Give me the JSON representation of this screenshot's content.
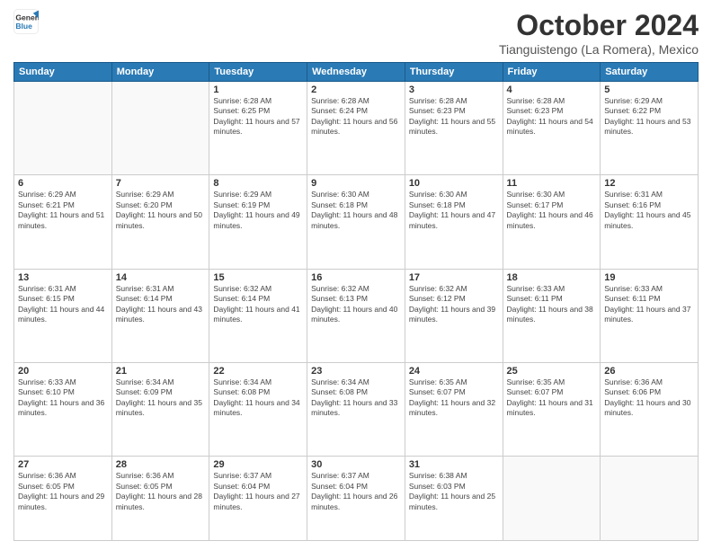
{
  "logo": {
    "line1": "General",
    "line2": "Blue"
  },
  "header": {
    "month": "October 2024",
    "location": "Tianguistengo (La Romera), Mexico"
  },
  "days_of_week": [
    "Sunday",
    "Monday",
    "Tuesday",
    "Wednesday",
    "Thursday",
    "Friday",
    "Saturday"
  ],
  "weeks": [
    [
      {
        "day": "",
        "empty": true
      },
      {
        "day": "",
        "empty": true
      },
      {
        "day": "1",
        "sunrise": "6:28 AM",
        "sunset": "6:25 PM",
        "daylight": "11 hours and 57 minutes."
      },
      {
        "day": "2",
        "sunrise": "6:28 AM",
        "sunset": "6:24 PM",
        "daylight": "11 hours and 56 minutes."
      },
      {
        "day": "3",
        "sunrise": "6:28 AM",
        "sunset": "6:23 PM",
        "daylight": "11 hours and 55 minutes."
      },
      {
        "day": "4",
        "sunrise": "6:28 AM",
        "sunset": "6:23 PM",
        "daylight": "11 hours and 54 minutes."
      },
      {
        "day": "5",
        "sunrise": "6:29 AM",
        "sunset": "6:22 PM",
        "daylight": "11 hours and 53 minutes."
      }
    ],
    [
      {
        "day": "6",
        "sunrise": "6:29 AM",
        "sunset": "6:21 PM",
        "daylight": "11 hours and 51 minutes."
      },
      {
        "day": "7",
        "sunrise": "6:29 AM",
        "sunset": "6:20 PM",
        "daylight": "11 hours and 50 minutes."
      },
      {
        "day": "8",
        "sunrise": "6:29 AM",
        "sunset": "6:19 PM",
        "daylight": "11 hours and 49 minutes."
      },
      {
        "day": "9",
        "sunrise": "6:30 AM",
        "sunset": "6:18 PM",
        "daylight": "11 hours and 48 minutes."
      },
      {
        "day": "10",
        "sunrise": "6:30 AM",
        "sunset": "6:18 PM",
        "daylight": "11 hours and 47 minutes."
      },
      {
        "day": "11",
        "sunrise": "6:30 AM",
        "sunset": "6:17 PM",
        "daylight": "11 hours and 46 minutes."
      },
      {
        "day": "12",
        "sunrise": "6:31 AM",
        "sunset": "6:16 PM",
        "daylight": "11 hours and 45 minutes."
      }
    ],
    [
      {
        "day": "13",
        "sunrise": "6:31 AM",
        "sunset": "6:15 PM",
        "daylight": "11 hours and 44 minutes."
      },
      {
        "day": "14",
        "sunrise": "6:31 AM",
        "sunset": "6:14 PM",
        "daylight": "11 hours and 43 minutes."
      },
      {
        "day": "15",
        "sunrise": "6:32 AM",
        "sunset": "6:14 PM",
        "daylight": "11 hours and 41 minutes."
      },
      {
        "day": "16",
        "sunrise": "6:32 AM",
        "sunset": "6:13 PM",
        "daylight": "11 hours and 40 minutes."
      },
      {
        "day": "17",
        "sunrise": "6:32 AM",
        "sunset": "6:12 PM",
        "daylight": "11 hours and 39 minutes."
      },
      {
        "day": "18",
        "sunrise": "6:33 AM",
        "sunset": "6:11 PM",
        "daylight": "11 hours and 38 minutes."
      },
      {
        "day": "19",
        "sunrise": "6:33 AM",
        "sunset": "6:11 PM",
        "daylight": "11 hours and 37 minutes."
      }
    ],
    [
      {
        "day": "20",
        "sunrise": "6:33 AM",
        "sunset": "6:10 PM",
        "daylight": "11 hours and 36 minutes."
      },
      {
        "day": "21",
        "sunrise": "6:34 AM",
        "sunset": "6:09 PM",
        "daylight": "11 hours and 35 minutes."
      },
      {
        "day": "22",
        "sunrise": "6:34 AM",
        "sunset": "6:08 PM",
        "daylight": "11 hours and 34 minutes."
      },
      {
        "day": "23",
        "sunrise": "6:34 AM",
        "sunset": "6:08 PM",
        "daylight": "11 hours and 33 minutes."
      },
      {
        "day": "24",
        "sunrise": "6:35 AM",
        "sunset": "6:07 PM",
        "daylight": "11 hours and 32 minutes."
      },
      {
        "day": "25",
        "sunrise": "6:35 AM",
        "sunset": "6:07 PM",
        "daylight": "11 hours and 31 minutes."
      },
      {
        "day": "26",
        "sunrise": "6:36 AM",
        "sunset": "6:06 PM",
        "daylight": "11 hours and 30 minutes."
      }
    ],
    [
      {
        "day": "27",
        "sunrise": "6:36 AM",
        "sunset": "6:05 PM",
        "daylight": "11 hours and 29 minutes."
      },
      {
        "day": "28",
        "sunrise": "6:36 AM",
        "sunset": "6:05 PM",
        "daylight": "11 hours and 28 minutes."
      },
      {
        "day": "29",
        "sunrise": "6:37 AM",
        "sunset": "6:04 PM",
        "daylight": "11 hours and 27 minutes."
      },
      {
        "day": "30",
        "sunrise": "6:37 AM",
        "sunset": "6:04 PM",
        "daylight": "11 hours and 26 minutes."
      },
      {
        "day": "31",
        "sunrise": "6:38 AM",
        "sunset": "6:03 PM",
        "daylight": "11 hours and 25 minutes."
      },
      {
        "day": "",
        "empty": true
      },
      {
        "day": "",
        "empty": true
      }
    ]
  ]
}
